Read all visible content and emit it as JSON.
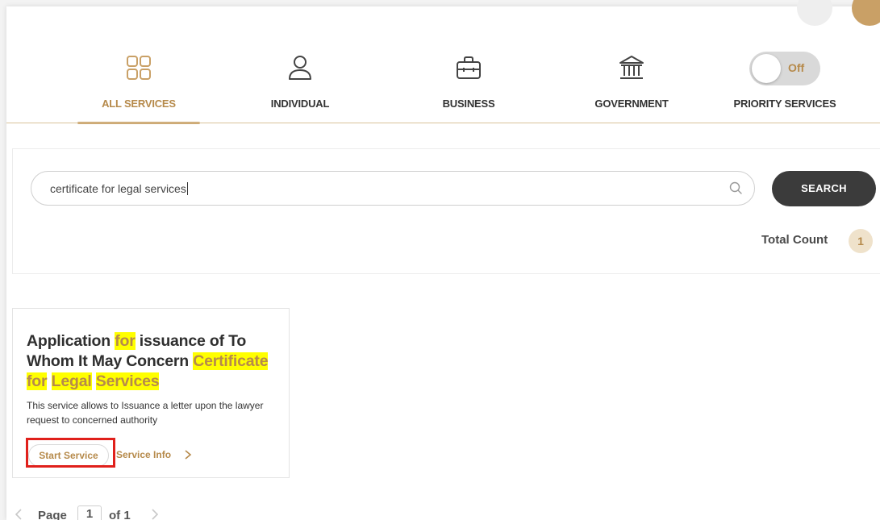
{
  "tabs": [
    {
      "label": "ALL SERVICES",
      "icon": "grid-icon",
      "active": true
    },
    {
      "label": "INDIVIDUAL",
      "icon": "person-icon",
      "active": false
    },
    {
      "label": "BUSINESS",
      "icon": "briefcase-icon",
      "active": false
    },
    {
      "label": "GOVERNMENT",
      "icon": "government-building-icon",
      "active": false
    }
  ],
  "priority": {
    "label": "PRIORITY SERVICES",
    "toggle_state": "Off"
  },
  "search": {
    "value": "certificate for legal services",
    "button_label": "SEARCH"
  },
  "results": {
    "total_label": "Total Count",
    "total_count": "1"
  },
  "card": {
    "title_parts": [
      "Application ",
      "for",
      " issuance of To Whom It May Concern ",
      "Certificate",
      " ",
      "for",
      " ",
      "Legal",
      " ",
      "Services"
    ],
    "description": "This service allows to Issuance a letter upon the lawyer request to concerned authority",
    "start_label": "Start Service",
    "info_label": "Service Info"
  },
  "pagination": {
    "page_label": "Page",
    "current_page": "1",
    "of_label": "of 1"
  },
  "colors": {
    "accent": "#c9a066",
    "accent_text": "#b68a4b",
    "dark_button": "#3b3b3b",
    "highlight": "#ffff00",
    "annotation_red": "#e0201b"
  }
}
